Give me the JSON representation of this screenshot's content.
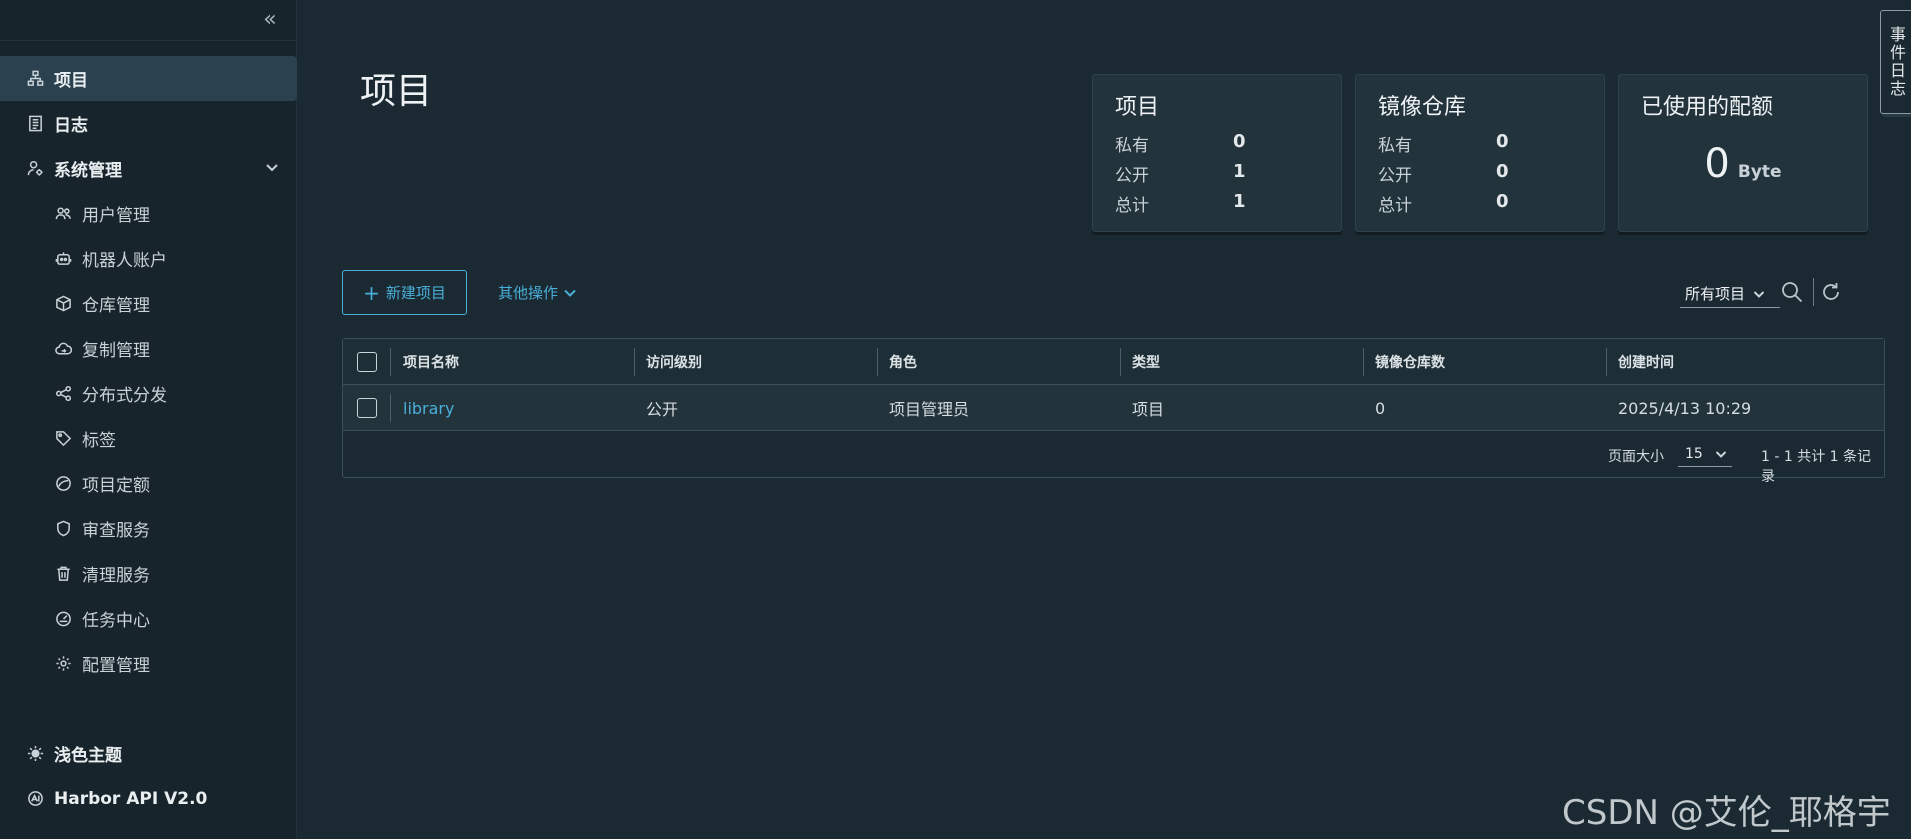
{
  "sidebar": {
    "items": [
      {
        "label": "项目",
        "icon": "project-icon"
      },
      {
        "label": "日志",
        "icon": "log-icon"
      },
      {
        "label": "系统管理",
        "icon": "admin-icon"
      },
      {
        "label": "用户管理",
        "icon": "users-icon"
      },
      {
        "label": "机器人账户",
        "icon": "robot-icon"
      },
      {
        "label": "仓库管理",
        "icon": "registry-icon"
      },
      {
        "label": "复制管理",
        "icon": "cloud-icon"
      },
      {
        "label": "分布式分发",
        "icon": "share-icon"
      },
      {
        "label": "标签",
        "icon": "tag-icon"
      },
      {
        "label": "项目定额",
        "icon": "quota-icon"
      },
      {
        "label": "审查服务",
        "icon": "shield-icon"
      },
      {
        "label": "清理服务",
        "icon": "trash-icon"
      },
      {
        "label": "任务中心",
        "icon": "dashboard-icon"
      },
      {
        "label": "配置管理",
        "icon": "gear-icon"
      }
    ],
    "bottom": [
      {
        "label": "浅色主题",
        "icon": "sun-icon"
      },
      {
        "label": "Harbor API V2.0",
        "icon": "api-icon"
      }
    ]
  },
  "page": {
    "title": "项目"
  },
  "cards": {
    "projects": {
      "title": "项目",
      "private_label": "私有",
      "private": "0",
      "public_label": "公开",
      "public": "1",
      "total_label": "总计",
      "total": "1"
    },
    "repos": {
      "title": "镜像仓库",
      "private_label": "私有",
      "private": "0",
      "public_label": "公开",
      "public": "0",
      "total_label": "总计",
      "total": "0"
    },
    "quota": {
      "title": "已使用的配额",
      "value": "0",
      "unit": "Byte"
    }
  },
  "toolbar": {
    "new_project": "新建项目",
    "other_actions": "其他操作",
    "filter": "所有项目"
  },
  "table": {
    "columns": [
      "项目名称",
      "访问级别",
      "角色",
      "类型",
      "镜像仓库数",
      "创建时间"
    ],
    "rows": [
      {
        "name": "library",
        "access": "公开",
        "role": "项目管理员",
        "type": "项目",
        "repo_count": "0",
        "created": "2025/4/13 10:29"
      }
    ],
    "footer": {
      "page_size_label": "页面大小",
      "page_size": "15",
      "info": "1 - 1 共计 1 条记录"
    }
  },
  "event_tab": {
    "label": "事件日志"
  },
  "watermark": "CSDN @艾伦_耶格宇",
  "colors": {
    "accent": "#49afd9",
    "background": "#1b2a32",
    "sidebar": "#17242b",
    "active": "#2b4150"
  }
}
